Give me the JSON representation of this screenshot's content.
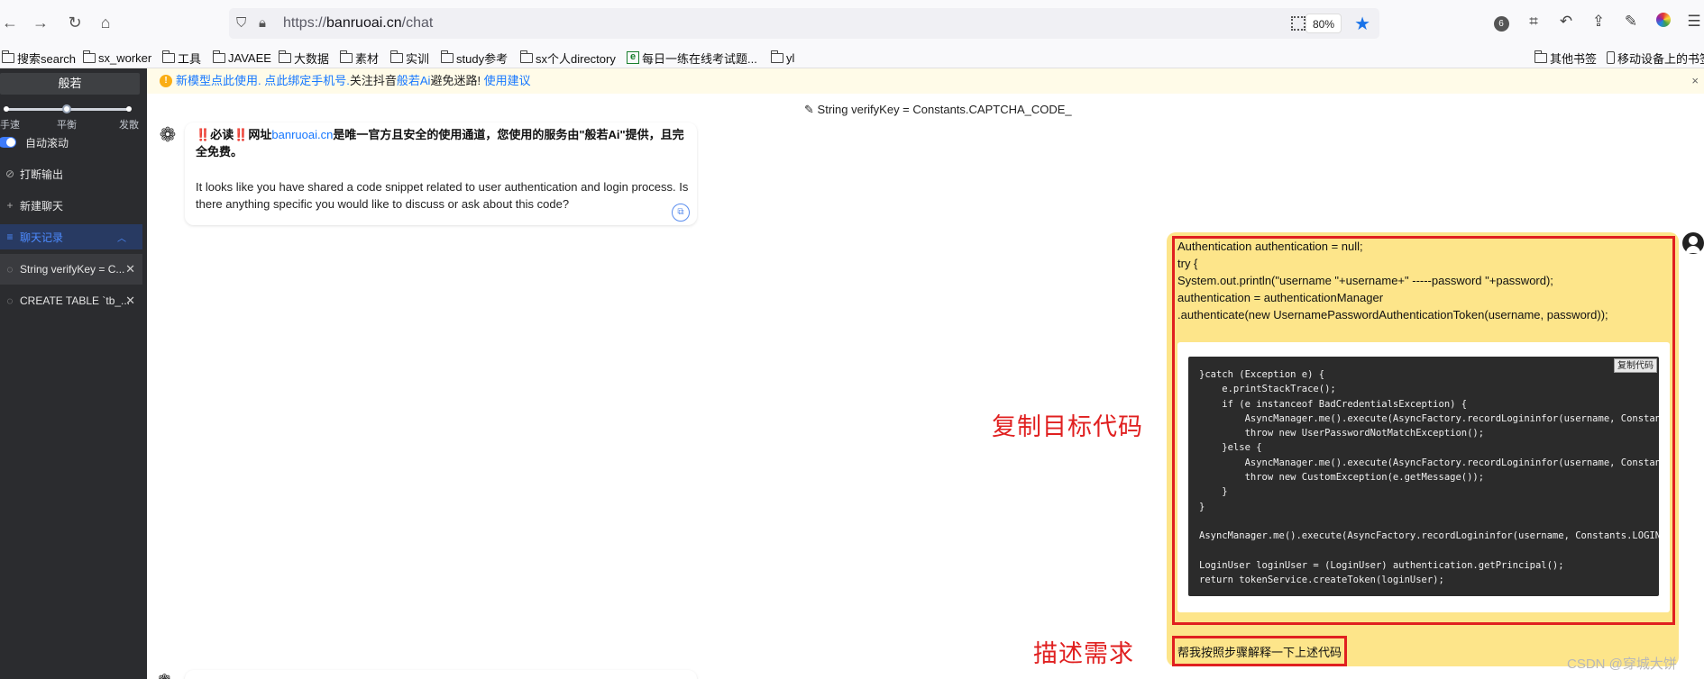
{
  "browser": {
    "url_prefix": "https://",
    "url_host": "banruoai.cn",
    "url_path": "/chat",
    "zoom": "80%",
    "ext_badge": "6",
    "icons": [
      "back-icon",
      "forward-icon",
      "reload-icon",
      "home-icon",
      "shield-icon",
      "lock-icon",
      "qr-code-icon",
      "star-icon",
      "crop-icon",
      "undo-icon",
      "share-icon",
      "pen-icon",
      "color-wheel-icon",
      "menu-icon"
    ]
  },
  "bookmarks": {
    "items": [
      "搜索search",
      "sx_worker",
      "工具",
      "JAVAEE",
      "大数据",
      "素材",
      "实训",
      "study参考",
      "sx个人directory",
      "每日一练在线考试题...",
      "yl"
    ],
    "right_items": [
      "其他书签",
      "移动设备上的书签"
    ]
  },
  "sidebar": {
    "title": "般若",
    "speed_labels": [
      "手速",
      "平衡",
      "发散"
    ],
    "speed_level": "平衡",
    "auto_scroll": "自动滚动",
    "interrupt": "打断输出",
    "new_chat": "新建聊天",
    "history": "聊天记录",
    "chats": [
      "String verifyKey = C...",
      "CREATE TABLE `tb_..."
    ]
  },
  "notice": {
    "part1": "新模型点此使用. ",
    "part2": "点此绑定手机号.",
    "part3": "关注抖音",
    "part4": "般若Ai",
    "part5": "避免迷路! ",
    "part6": "使用建议",
    "close": "×"
  },
  "chat": {
    "title": "String verifyKey = Constants.CAPTCHA_CODE_",
    "bot_notice_mark": "‼️",
    "bot_notice_a": "必读",
    "bot_notice_b": "网址",
    "bot_notice_link": "banruoai.cn",
    "bot_notice_c": "是唯一官方且安全的使用通道，您使用的服务由\"般若Ai\"提供，且完全免费。",
    "bot_reply": "It looks like you have shared a code snippet related to user authentication and login process. Is there anything specific you would like to discuss or ask about this code?",
    "user_code_text": "Authentication authentication = null;\ntry {\nSystem.out.println(\"username \"+username+\" -----password \"+password);\nauthentication = authenticationManager\n.authenticate(new UsernamePasswordAuthenticationToken(username, password));",
    "code_block": "}catch (Exception e) {\n    e.printStackTrace();\n    if (e instanceof BadCredentialsException) {\n        AsyncManager.me().execute(AsyncFactory.recordLogininfor(username, Constants.LOGIN_FAIL\n        throw new UserPasswordNotMatchException();\n    }else {\n        AsyncManager.me().execute(AsyncFactory.recordLogininfor(username, Constants.LOGIN_FAIL\n        throw new CustomException(e.getMessage());\n    }\n}\n\nAsyncManager.me().execute(AsyncFactory.recordLogininfor(username, Constants.LOGIN_SUCCESS\n\nLoginUser loginUser = (LoginUser) authentication.getPrincipal();\nreturn tokenService.createToken(loginUser);",
    "code_copy_label": "复制代码",
    "user_request": "帮我按照步骤解释一下上述代码"
  },
  "annotations": {
    "copy_code": "复制目标代码",
    "describe": "描述需求"
  },
  "watermark": "CSDN @穿城大饼",
  "colors": {
    "accent": "#1677ff",
    "user_bubble": "#fde58a",
    "annotation_red": "#e02020",
    "sidebar_bg": "#2b2c2f"
  }
}
